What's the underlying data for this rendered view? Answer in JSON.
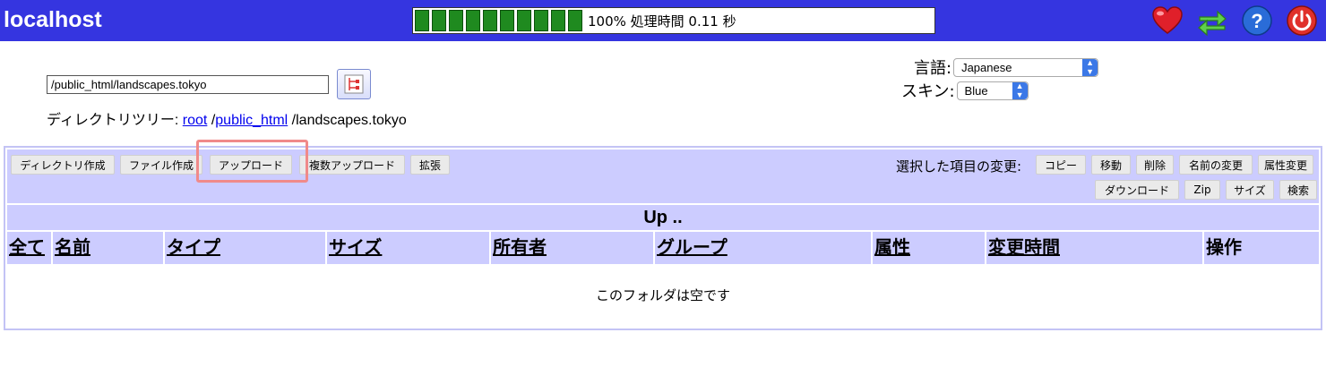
{
  "header": {
    "site": "localhost",
    "progress_text": "100% 処理時間 0.11 秒",
    "progress_percent": 100,
    "progress_color": "#1f8a1f",
    "bg_color": "#3535e0",
    "icons": [
      "heart-icon",
      "refresh-icon",
      "help-icon",
      "power-icon"
    ]
  },
  "path": {
    "value": "/public_html/landscapes.tokyo"
  },
  "dirtree": {
    "label": "ディレクトリツリー:",
    "root": "root",
    "sep1": "/",
    "public_html": "public_html",
    "sep2": "/",
    "current": "landscapes.tokyo"
  },
  "settings": {
    "lang_label": "言語:",
    "lang_value": "Japanese",
    "skin_label": "スキン:",
    "skin_value": "Blue"
  },
  "toolbar": {
    "mkdir": "ディレクトリ作成",
    "mkfile": "ファイル作成",
    "upload": "アップロード",
    "multi_upload": "複数アップロード",
    "extend": "拡張",
    "selected_label": "選択した項目の変更:",
    "copy": "コピー",
    "move": "移動",
    "delete": "削除",
    "rename": "名前の変更",
    "chmod": "属性変更",
    "download": "ダウンロード",
    "zip": "Zip",
    "size": "サイズ",
    "search": "検索"
  },
  "table": {
    "up": "Up ..",
    "columns": [
      "全て",
      "名前",
      "タイプ",
      "サイズ",
      "所有者",
      "グループ",
      "属性",
      "変更時間",
      "操作"
    ],
    "empty_message": "このフォルダは空です",
    "header_bg": "#ccccff"
  }
}
